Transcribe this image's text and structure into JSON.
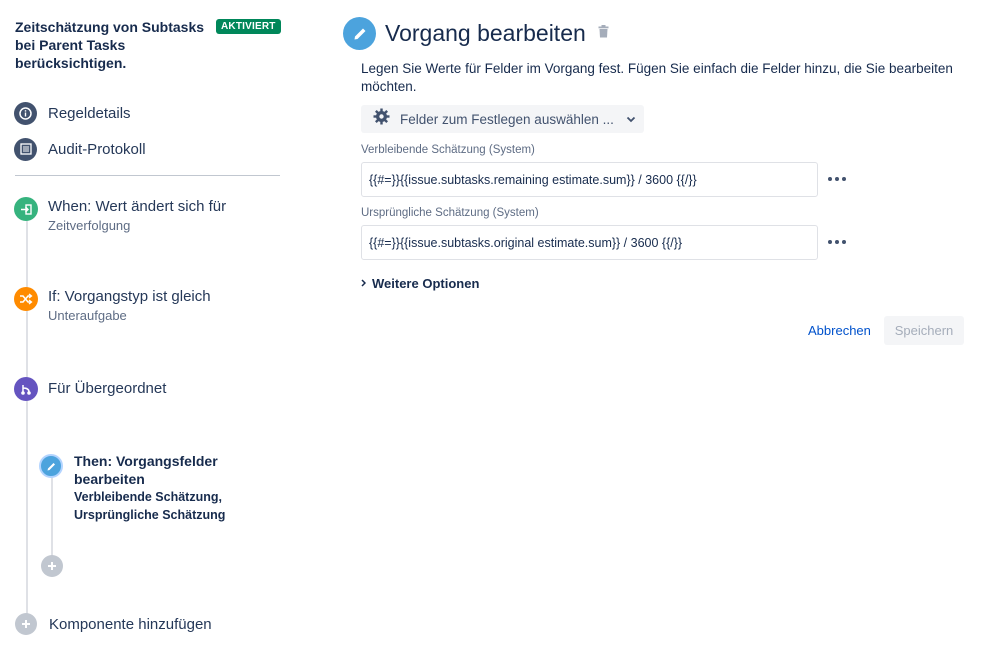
{
  "rule": {
    "title": "Zeitschätzung von Subtasks bei Parent Tasks berücksichtigen.",
    "status_badge": "AKTIVIERT"
  },
  "nav": {
    "items": [
      {
        "label": "Regeldetails",
        "icon": "info-icon"
      },
      {
        "label": "Audit-Protokoll",
        "icon": "list-icon"
      }
    ]
  },
  "flow": {
    "trigger": {
      "title": "When: Wert ändert sich für",
      "subtitle": "Zeitverfolgung",
      "icon": "trigger-icon",
      "color": "#36b37e"
    },
    "condition": {
      "title": "If: Vorgangstyp ist gleich",
      "subtitle": "Unteraufgabe",
      "icon": "shuffle-icon",
      "color": "#ff8b00"
    },
    "branch": {
      "title": "Für Übergeordnet",
      "icon": "branch-icon",
      "color": "#6554c0"
    },
    "action": {
      "title": "Then: Vorgangsfelder bearbeiten",
      "fields_line1": "Verbleibende Schätzung,",
      "fields_line2": "Ursprüngliche Schätzung",
      "icon": "pencil-icon",
      "color": "#4ca3dd"
    },
    "add_component_label": "Komponente hinzufügen"
  },
  "editor": {
    "title": "Vorgang bearbeiten",
    "description": "Legen Sie Werte für Felder im Vorgang fest. Fügen Sie einfach die Felder hinzu, die Sie bearbeiten möchten.",
    "field_select_label": "Felder zum Festlegen auswählen ...",
    "fields": [
      {
        "label": "Verbleibende Schätzung (System)",
        "value": "{{#=}}{{issue.subtasks.remaining estimate.sum}} / 3600 {{/}}"
      },
      {
        "label": "Ursprüngliche Schätzung (System)",
        "value": "{{#=}}{{issue.subtasks.original estimate.sum}} / 3600 {{/}}"
      }
    ],
    "more_options_label": "Weitere Optionen",
    "cancel_label": "Abbrechen",
    "save_label": "Speichern"
  }
}
